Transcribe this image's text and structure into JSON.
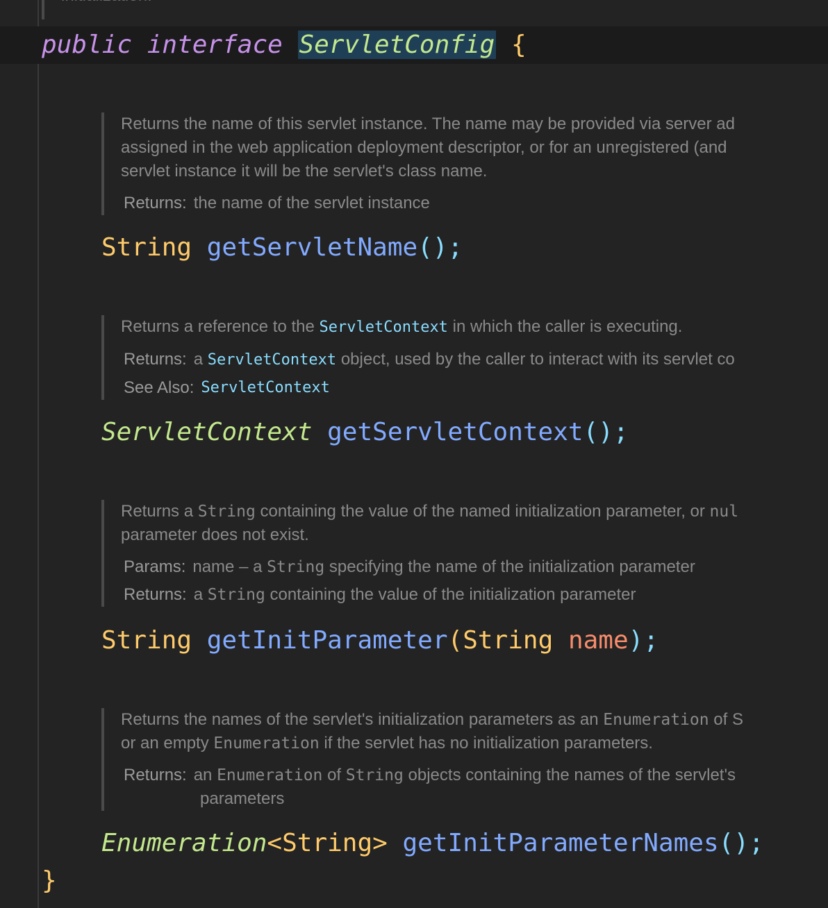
{
  "header": {
    "top_doc": "initialization.",
    "keyword_public": "public",
    "keyword_interface": "interface",
    "interface_name": "ServletConfig",
    "open_brace": "{",
    "close_brace": "}"
  },
  "methods": [
    {
      "doc_line1": "Returns the name of this servlet instance. The name may be provided via server ad",
      "doc_line2": "assigned in the web application deployment descriptor, or for an unregistered (and",
      "doc_line3": "servlet instance it will be the servlet's class name.",
      "returns_label": "Returns:",
      "returns_text": "the name of the servlet instance",
      "return_type": "String",
      "name": "getServletName",
      "sig_end": "();"
    },
    {
      "doc_pre": "Returns a reference to the ",
      "doc_link": "ServletContext",
      "doc_post": " in which the caller is executing.",
      "returns_label": "Returns:",
      "returns_pre": "a ",
      "returns_link": "ServletContext",
      "returns_post": " object, used by the caller to interact with its servlet co",
      "see_label": "See Also:",
      "see_link": "ServletContext",
      "return_type": "ServletContext",
      "name": "getServletContext",
      "sig_end": "();"
    },
    {
      "doc_pre": "Returns a ",
      "doc_code": "String",
      "doc_post": " containing the value of the named initialization parameter, or ",
      "doc_code2": "nul",
      "doc_line2": "parameter does not exist.",
      "params_label": "Params:",
      "params_pre": "name – a ",
      "params_code": "String",
      "params_post": " specifying the name of the initialization parameter",
      "returns_label": "Returns:",
      "returns_pre": "a ",
      "returns_code": "String",
      "returns_post": " containing the value of the initialization parameter",
      "return_type": "String",
      "name": "getInitParameter",
      "open_paren": "(",
      "param_type": "String",
      "param_name": "name",
      "sig_end": ");"
    },
    {
      "doc_pre": "Returns the names of the servlet's initialization parameters as an ",
      "doc_code": "Enumeration",
      "doc_post": " of S",
      "doc_line2_pre": "or an empty ",
      "doc_line2_code": "Enumeration",
      "doc_line2_post": " if the servlet has no initialization parameters.",
      "returns_label": "Returns:",
      "returns_pre": "an ",
      "returns_code": "Enumeration",
      "returns_mid": " of ",
      "returns_code2": "String",
      "returns_post": " objects containing the names of the servlet's",
      "returns_line2": "parameters",
      "return_type": "Enumeration",
      "generic": "<String>",
      "name": "getInitParameterNames",
      "sig_end": "();"
    }
  ]
}
